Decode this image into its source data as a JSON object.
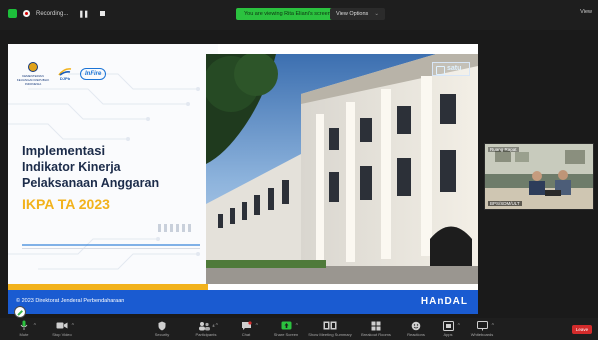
{
  "topbar": {
    "recording_label": "Recording...",
    "screen_banner": "You are viewing Rita Eliani's screen",
    "view_options": "View Options",
    "top_right_label": "View"
  },
  "slide": {
    "logos": {
      "kemenkeu_text": "KEMENTERIAN KEUANGAN REPUBLIK INDONESIA",
      "djpb_text": "DJPb",
      "infire_text": "InFire"
    },
    "title_line1": "Implementasi",
    "title_line2": "Indikator Kinerja",
    "title_line3": "Pelaksanaan Anggaran",
    "title_line4": "IKPA TA 2023",
    "satu_logo": "satu",
    "footer_text": "© 2023 Direktorat Jenderal Perbendaharaan",
    "brand": "HAnDAL"
  },
  "video": {
    "name": "Ruang Rapat",
    "caption": "BPS/SDM/ULT"
  },
  "toolbar": {
    "mute": "Mute",
    "stop_video": "Stop Video",
    "security": "Security",
    "participants": "Participants",
    "participants_count": "4",
    "chat": "Chat",
    "share_screen": "Share Screen",
    "summary": "Show Meeting Summary",
    "breakout": "Breakout Rooms",
    "reactions": "Reactions",
    "apps": "Apps",
    "whiteboards": "Whiteboards",
    "leave": "Leave"
  },
  "colors": {
    "banner_green": "#2bc23f",
    "footer_blue": "#1a5bd1",
    "title_navy": "#1c2c4a",
    "accent_yellow": "#f2b21c",
    "leave_red": "#d32b2b"
  }
}
